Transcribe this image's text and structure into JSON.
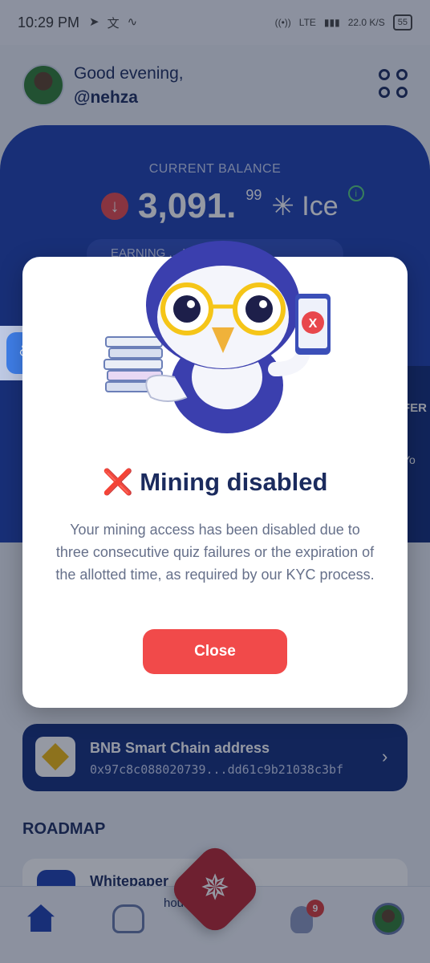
{
  "status_bar": {
    "time": "10:29 PM",
    "network": "LTE",
    "speed": "22.0 K/S",
    "battery": "55"
  },
  "header": {
    "greeting": "Good evening,",
    "username": "@nehza"
  },
  "balance": {
    "label": "CURRENT BALANCE",
    "value": "3,091.",
    "decimals": "99",
    "unit": "✳ Ice",
    "earning_label": "EARNING ... Ice/h"
  },
  "side_panel": {
    "text": "FER",
    "sub": "Yo"
  },
  "wallet": {
    "title": "BNB Smart Chain address",
    "address": "0x97c8c088020739...dd61c9b21038c3bf"
  },
  "roadmap": {
    "title": "ROADMAP",
    "item": "Whitepaper"
  },
  "bottom_nav": {
    "ticker": "hou... n at",
    "tips_count": "9"
  },
  "modal": {
    "x_mark": "❌",
    "title": "Mining disabled",
    "body": "Your mining access has been disabled due to three consecutive quiz failures or the expiration of the allotted time, as required by our KYC process.",
    "close_label": "Close",
    "phone_mark": "X"
  },
  "translator": {
    "label": "ऀT"
  },
  "colors": {
    "primary": "#1c3fb0",
    "danger": "#f14a4a",
    "text_dark": "#1b2b5e"
  }
}
